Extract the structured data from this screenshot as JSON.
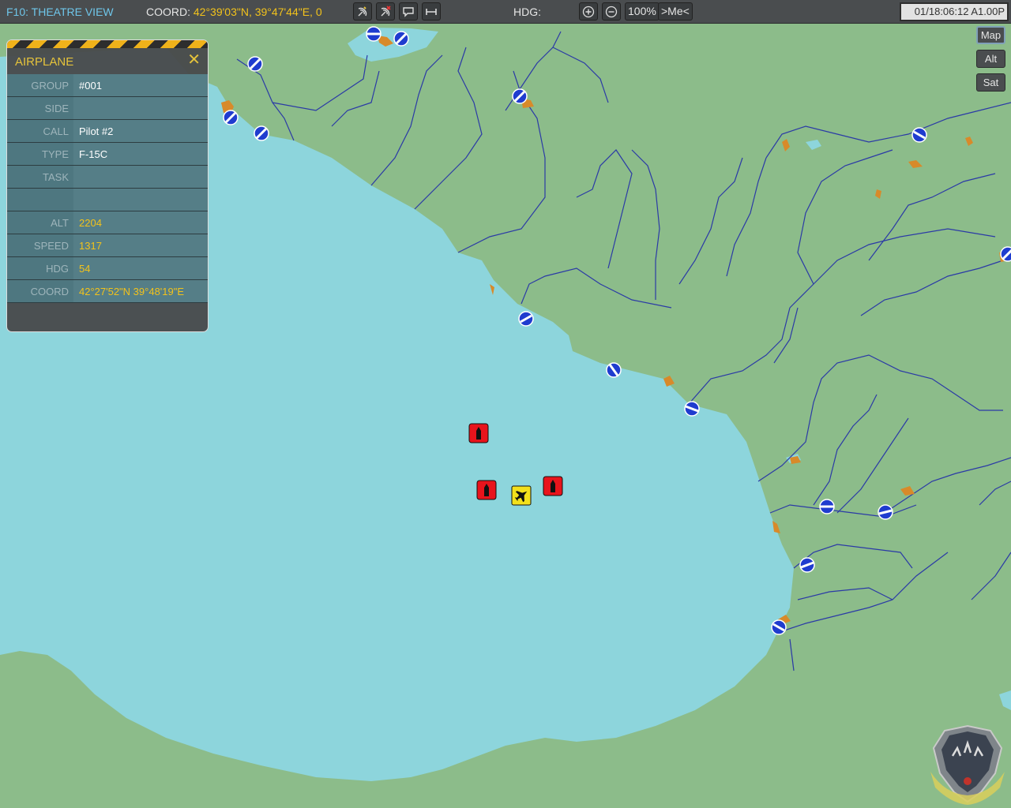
{
  "topbar": {
    "view_title": "F10: THEATRE VIEW",
    "coord_label": "COORD:",
    "coord_value": "42°39'03\"N, 39°47'44\"E, 0",
    "hdg_label": "HDG:",
    "zoom": "100%",
    "me_button": ">Me<",
    "clock": "01/18:06:12 A1.00P"
  },
  "toolbar_icons": [
    "satellite-icon",
    "satellite-off-icon",
    "message-icon",
    "ruler-icon"
  ],
  "map_modes": [
    "Map",
    "Alt",
    "Sat"
  ],
  "map_mode_active": "Map",
  "panel": {
    "title": "AIRPLANE",
    "close": "✕",
    "rows": [
      {
        "key": "GROUP",
        "value": "#001",
        "highlight": false
      },
      {
        "key": "SIDE",
        "value": "",
        "highlight": false
      },
      {
        "key": "CALL",
        "value": "Pilot #2",
        "highlight": false
      },
      {
        "key": "TYPE",
        "value": "F-15C",
        "highlight": false
      },
      {
        "key": "TASK",
        "value": "",
        "highlight": false
      },
      {
        "key": "",
        "value": "",
        "highlight": false
      },
      {
        "key": "ALT",
        "value": "2204",
        "highlight": true
      },
      {
        "key": "SPEED",
        "value": "1317",
        "highlight": true
      },
      {
        "key": "HDG",
        "value": "54",
        "highlight": true
      },
      {
        "key": "COORD",
        "value": "42°27'52\"N  39°48'19\"E",
        "highlight": true
      }
    ]
  },
  "colors": {
    "land": "#8cbc8a",
    "sea": "#8dd5dc",
    "river": "#2b3aa6",
    "airbase": "#1f3ccf",
    "hostile_unit": "#e8141c",
    "player_unit": "#f3e01c",
    "town": "#d88a2a",
    "accent": "#f2c21b"
  },
  "map_symbols": {
    "airbases": 18,
    "hostile_ships": 3,
    "player_aircraft": 1
  }
}
